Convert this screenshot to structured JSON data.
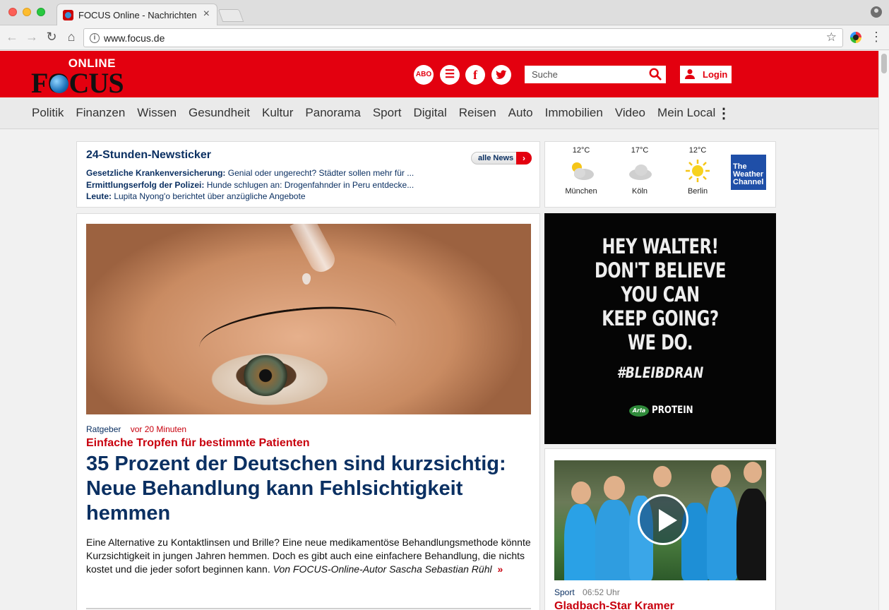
{
  "browser": {
    "tab_title": "FOCUS Online - Nachrichten",
    "tab_close": "×",
    "url": "www.focus.de"
  },
  "header": {
    "logo_online": "ONLINE",
    "logo_focus": "FOCUS",
    "abo": "ABO",
    "search_placeholder": "Suche",
    "login": "Login"
  },
  "nav": {
    "items": [
      "Politik",
      "Finanzen",
      "Wissen",
      "Gesundheit",
      "Kultur",
      "Panorama",
      "Sport",
      "Digital",
      "Reisen",
      "Auto",
      "Immobilien",
      "Video",
      "Mein Local"
    ],
    "more": "⋮"
  },
  "ticker": {
    "title": "24-Stunden-Newsticker",
    "all_news": "alle News",
    "items": [
      {
        "category": "Gesetzliche Krankenversicherung:",
        "text": " Genial oder ungerecht? Städter sollen mehr für ..."
      },
      {
        "category": "Ermittlungserfolg der Polizei:",
        "text": " Hunde schlugen an: Drogenfahnder in Peru entdecke..."
      },
      {
        "category": "Leute:",
        "text": " Lupita Nyong'o berichtet über anzügliche Angebote"
      }
    ]
  },
  "weather": {
    "cities": [
      {
        "temp": "12°C",
        "city": "München",
        "icon": "partly-cloudy-icon"
      },
      {
        "temp": "17°C",
        "city": "Köln",
        "icon": "cloud-icon"
      },
      {
        "temp": "12°C",
        "city": "Berlin",
        "icon": "sun-icon"
      }
    ],
    "brand": "The Weather Channel"
  },
  "main_article": {
    "category": "Ratgeber",
    "time": "vor 20 Minuten",
    "kicker": "Einfache Tropfen für bestimmte Patienten",
    "headline": "35 Prozent der Deutschen sind kurzsichtig: Neue Behandlung kann Fehlsichtigkeit hemmen",
    "teaser": "Eine Alternative zu Kontaktlinsen und Brille? Eine neue medikamentöse Behandlungsmethode könnte Kurzsichtigkeit in jungen Jahren hemmen. Doch es gibt auch eine einfachere Behandlung, die nichts kostet und die jeder sofort beginnen kann.",
    "author": "Von FOCUS-Online-Autor Sascha Sebastian Rühl",
    "more": "»"
  },
  "ad": {
    "line1": "HEY WALTER!",
    "line2": "DON'T BELIEVE",
    "line3": "YOU CAN",
    "line4": "KEEP GOING?",
    "line5": "WE DO.",
    "hashtag": "#BLEIBDRAN",
    "brand_logo": "Arla",
    "brand": "PROTEIN"
  },
  "sport_article": {
    "category": "Sport",
    "time": "06:52 Uhr",
    "headline": "Gladbach-Star Kramer"
  },
  "colors": {
    "brand_red": "#e3000f",
    "headline_blue": "#0b3062",
    "kicker_red": "#c8000d"
  }
}
